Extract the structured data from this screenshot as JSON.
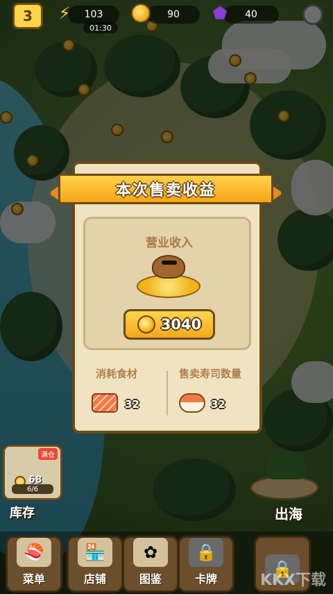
{
  "hud": {
    "level": "3",
    "energy": "103",
    "energy_timer": "01:30",
    "coins": "90",
    "gems": "40",
    "icons": [
      "lightning-icon",
      "coin-icon",
      "gem-icon",
      "gear-icon"
    ]
  },
  "modal": {
    "title": "本次售卖收益",
    "income_label": "营业收入",
    "income_amount": "3040",
    "stats": [
      {
        "label": "消耗食材",
        "value": "32",
        "icon": "salmon-icon"
      },
      {
        "label": "售卖寿司数量",
        "value": "32",
        "icon": "sushi-icon"
      }
    ]
  },
  "side": {
    "storage_label": "库存",
    "badge": "满仓",
    "coins": "68",
    "capacity": "6/6",
    "sea_label": "出海"
  },
  "bottom_tabs": [
    {
      "label": "菜单",
      "icon": "menu-book-icon",
      "locked": false
    },
    {
      "label": "店铺",
      "icon": "shop-icon",
      "locked": false
    },
    {
      "label": "图鉴",
      "icon": "collection-icon",
      "locked": false
    },
    {
      "label": "卡牌",
      "icon": "lock-icon",
      "locked": true
    }
  ],
  "watermark": "KKX下载"
}
